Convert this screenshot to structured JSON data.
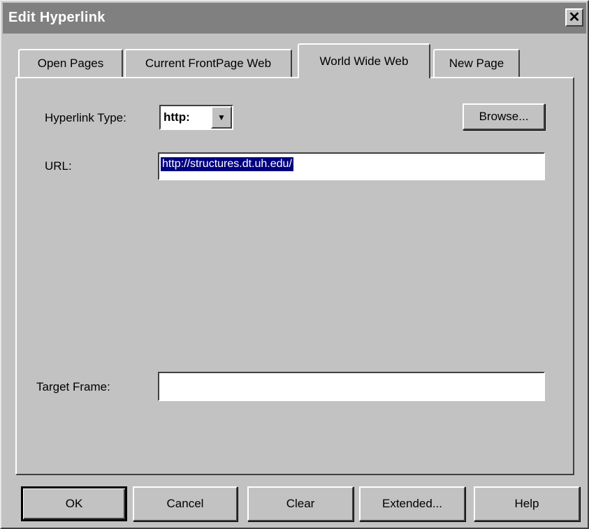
{
  "dialog": {
    "title": "Edit Hyperlink",
    "close_glyph": "✕"
  },
  "tabs": [
    {
      "label": "Open Pages"
    },
    {
      "label": "Current FrontPage Web"
    },
    {
      "label": "World Wide Web"
    },
    {
      "label": "New Page"
    }
  ],
  "form": {
    "hyperlink_type_label": "Hyperlink Type:",
    "hyperlink_type_value": "http:",
    "combo_arrow_glyph": "▼",
    "browse_label": "Browse...",
    "url_label": "URL:",
    "url_value": "http://structures.dt.uh.edu/",
    "target_frame_label": "Target Frame:",
    "target_frame_value": ""
  },
  "buttons": {
    "ok": "OK",
    "cancel": "Cancel",
    "clear": "Clear",
    "extended": "Extended...",
    "help": "Help"
  }
}
